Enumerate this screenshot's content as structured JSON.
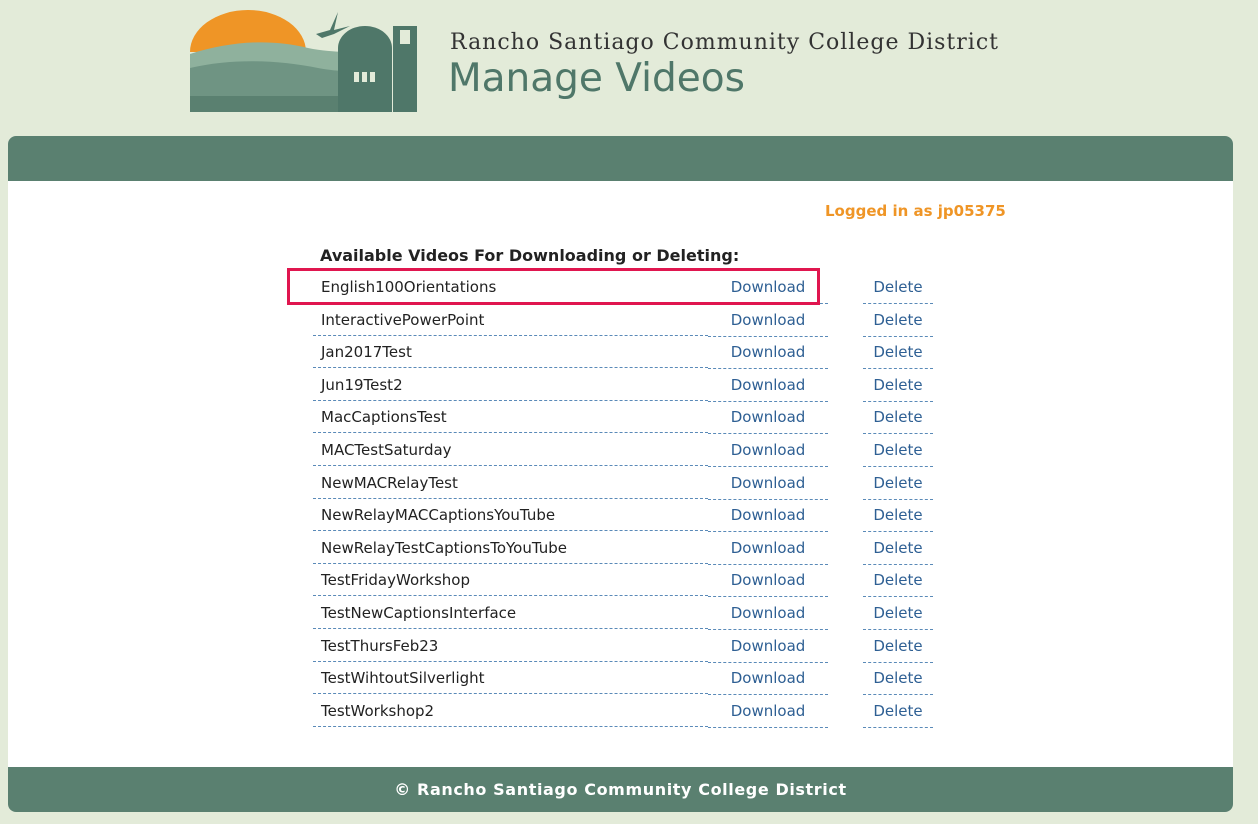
{
  "header": {
    "district_name": "Rancho Santiago Community College District",
    "page_title": "Manage Videos"
  },
  "status": {
    "logged_in_text": "Logged in as jp05375"
  },
  "list": {
    "heading": "Available Videos For Downloading or Deleting:",
    "download_label": "Download",
    "delete_label": "Delete",
    "videos": [
      "English100Orientations",
      "InteractivePowerPoint",
      "Jan2017Test",
      "Jun19Test2",
      "MacCaptionsTest",
      "MACTestSaturday",
      "NewMACRelayTest",
      "NewRelayMACCaptionsYouTube",
      "NewRelayTestCaptionsToYouTube",
      "TestFridayWorkshop",
      "TestNewCaptionsInterface",
      "TestThursFeb23",
      "TestWihtoutSilverlight",
      "TestWorkshop2"
    ]
  },
  "footer": {
    "copyright": "© Rancho Santiago Community College District"
  },
  "colors": {
    "page_background": "#e3ebd9",
    "bar_green": "#5a8070",
    "title_green": "#4f7769",
    "logged_in_orange": "#ef9526",
    "link_blue": "#2e5f93",
    "highlight_red": "#e0164f"
  }
}
